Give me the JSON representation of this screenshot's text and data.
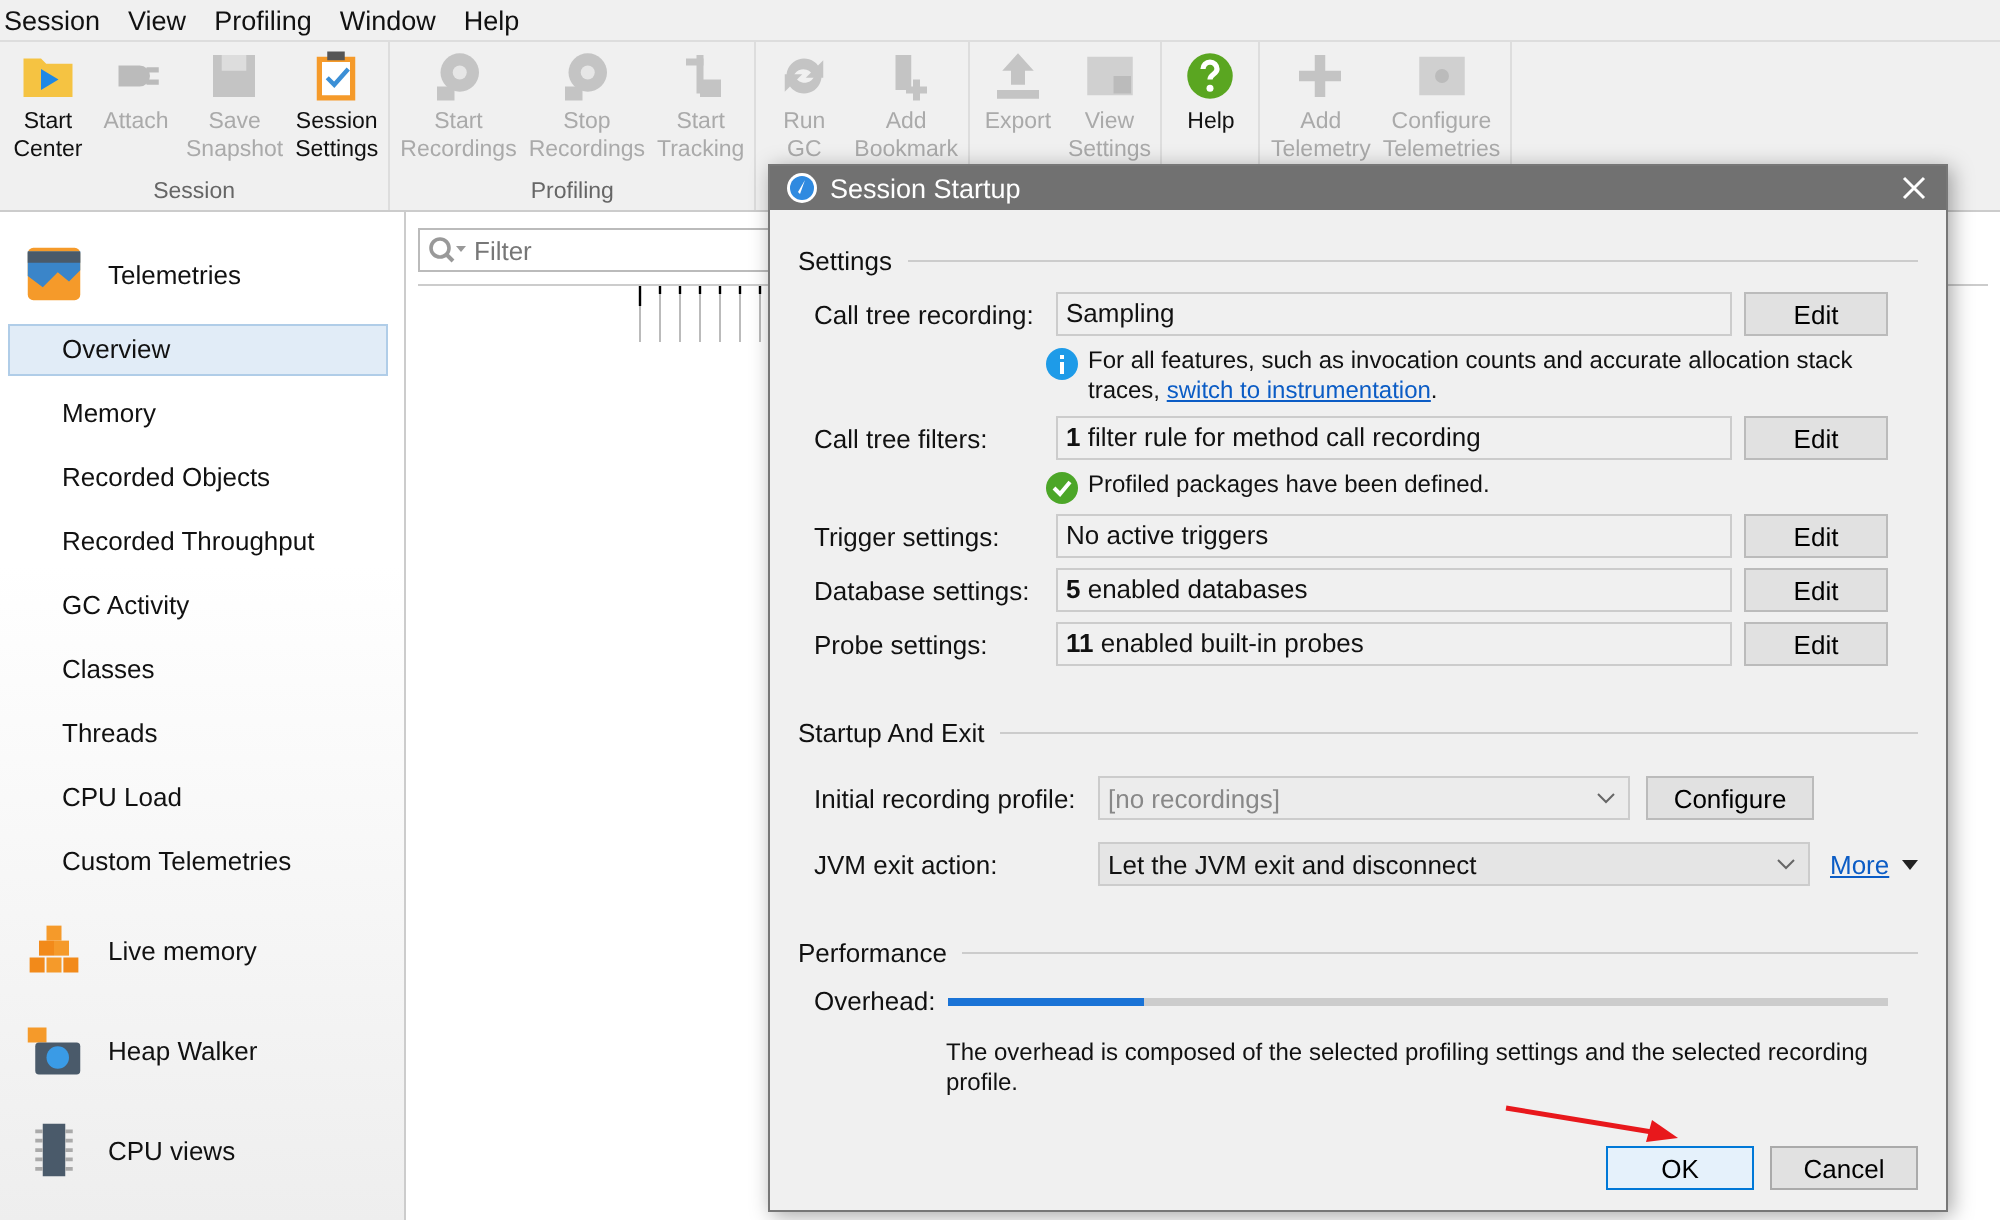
{
  "menu": [
    "Session",
    "View",
    "Profiling",
    "Window",
    "Help"
  ],
  "toolbar": [
    {
      "label": "Session",
      "buttons": [
        {
          "label": "Start Center",
          "disabled": false
        },
        {
          "label": "Attach",
          "disabled": true
        },
        {
          "label": "Save Snapshot",
          "disabled": true
        },
        {
          "label": "Session Settings",
          "disabled": false
        }
      ]
    },
    {
      "label": "Profiling",
      "buttons": [
        {
          "label": "Start Recordings",
          "disabled": true
        },
        {
          "label": "Stop Recordings",
          "disabled": true
        },
        {
          "label": "Start Tracking",
          "disabled": true
        }
      ]
    },
    {
      "buttons": [
        {
          "label": "Run GC",
          "disabled": true
        },
        {
          "label": "Add Bookmark",
          "disabled": true
        }
      ]
    },
    {
      "buttons": [
        {
          "label": "Export",
          "disabled": true
        },
        {
          "label": "View Settings",
          "disabled": true
        }
      ]
    },
    {
      "buttons": [
        {
          "label": "Help",
          "disabled": false
        }
      ]
    },
    {
      "buttons": [
        {
          "label": "Add Telemetry",
          "disabled": true
        },
        {
          "label": "Configure Telemetries",
          "disabled": true
        }
      ]
    }
  ],
  "sidebar": [
    {
      "label": "Telemetries",
      "items": [
        {
          "label": "Overview",
          "selected": true
        },
        {
          "label": "Memory",
          "selected": false
        },
        {
          "label": "Recorded Objects",
          "selected": false
        },
        {
          "label": "Recorded Throughput",
          "selected": false
        },
        {
          "label": "GC Activity",
          "selected": false
        },
        {
          "label": "Classes",
          "selected": false
        },
        {
          "label": "Threads",
          "selected": false
        },
        {
          "label": "CPU Load",
          "selected": false
        },
        {
          "label": "Custom Telemetries",
          "selected": false
        }
      ]
    },
    {
      "label": "Live memory"
    },
    {
      "label": "Heap Walker"
    },
    {
      "label": "CPU views"
    }
  ],
  "filter": {
    "placeholder": "Filter"
  },
  "dialog": {
    "title": "Session Startup",
    "settings": {
      "heading": "Settings",
      "rows": [
        {
          "label": "Call tree recording:",
          "value": "Sampling",
          "button": "Edit",
          "note": {
            "kind": "info",
            "text": "For all features, such as invocation counts and accurate allocation stack traces, ",
            "link": "switch to instrumentation",
            "after": "."
          }
        },
        {
          "label": "Call tree filters:",
          "value": "**1** filter rule for method call recording",
          "button": "Edit",
          "note": {
            "kind": "success",
            "text": "Profiled packages have been defined."
          }
        },
        {
          "label": "Trigger settings:",
          "value": "No active triggers",
          "button": "Edit"
        },
        {
          "label": "Database settings:",
          "value": "**5** enabled databases",
          "button": "Edit"
        },
        {
          "label": "Probe settings:",
          "value": "**11** enabled built-in probes",
          "button": "Edit"
        }
      ]
    },
    "startup": {
      "heading": "Startup And Exit",
      "rows": [
        {
          "label": "Initial recording profile:",
          "value": "[no recordings]",
          "disabled": true,
          "button": "Configure"
        },
        {
          "label": "JVM exit action:",
          "value": "Let the JVM exit and disconnect",
          "disabled": false,
          "link": "More"
        }
      ]
    },
    "performance": {
      "heading": "Performance",
      "label": "Overhead:",
      "level": 0.21,
      "description": "The overhead is composed of the selected profiling settings and the selected recording profile."
    },
    "buttons": [
      {
        "label": "OK",
        "default": true
      },
      {
        "label": "Cancel",
        "default": false
      }
    ]
  }
}
